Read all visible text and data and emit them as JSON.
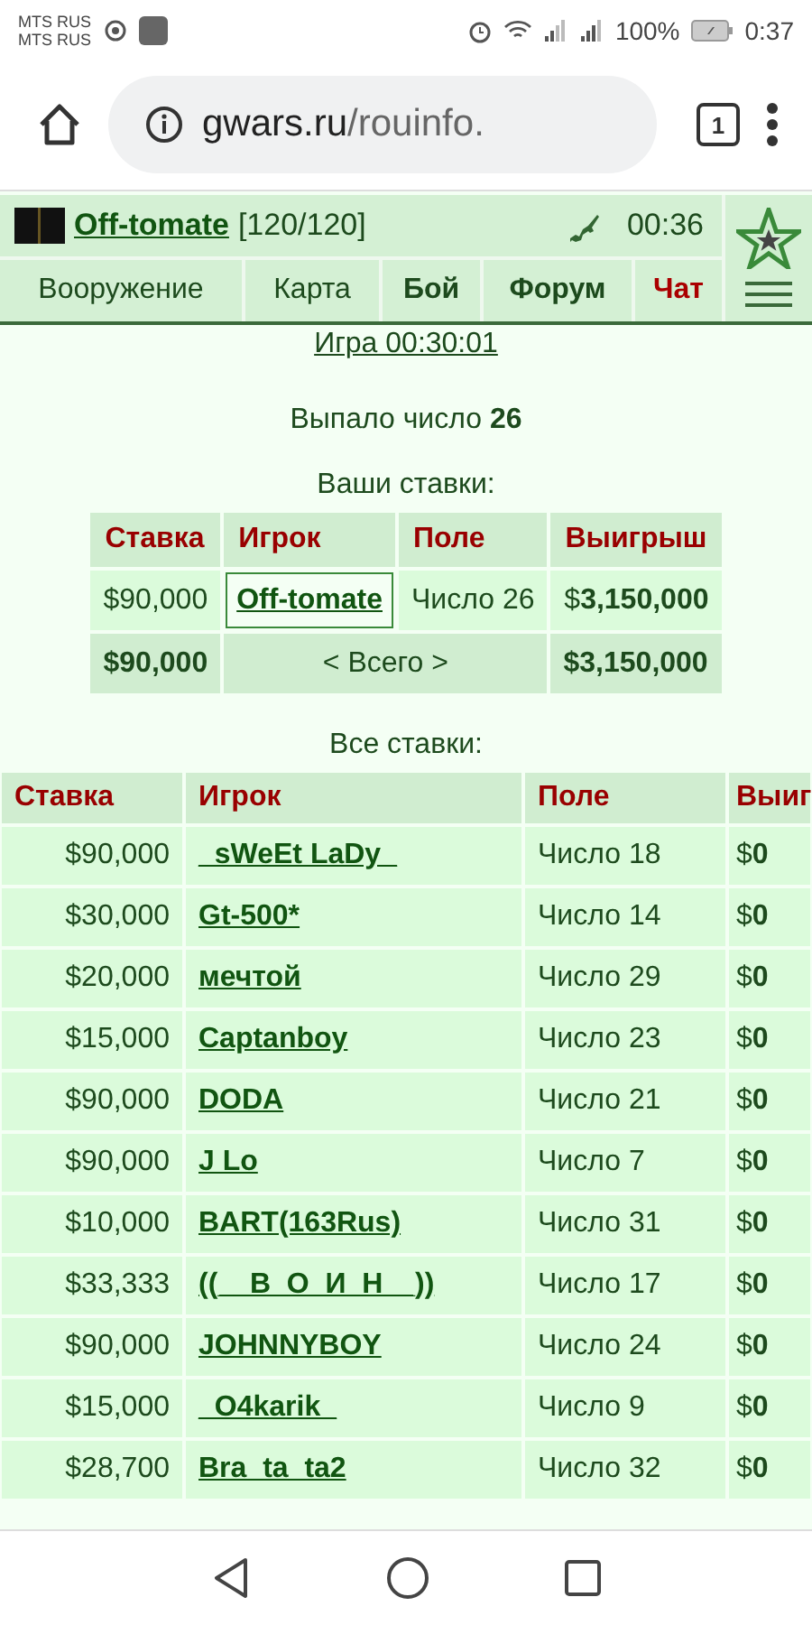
{
  "status_bar": {
    "carrier_1": "MTS RUS",
    "carrier_2": "MTS RUS",
    "battery": "100%",
    "time": "0:37"
  },
  "browser": {
    "url_host": "gwars.ru",
    "url_path": "/rouinfo.",
    "tab_count": "1"
  },
  "header": {
    "player": "Off-tomate",
    "health": "[120/120]",
    "timer": "00:36"
  },
  "nav": [
    {
      "label": "Вооружение",
      "kind": "normal"
    },
    {
      "label": "Карта",
      "kind": "normal"
    },
    {
      "label": "Бой",
      "kind": "bold"
    },
    {
      "label": "Форум",
      "kind": "bold"
    },
    {
      "label": "Чат",
      "kind": "alert"
    }
  ],
  "game_link": "Игра 00:30:01",
  "result": "Выпало число **26**",
  "my_bets": {
    "title": "Ваши ставки:",
    "columns": [
      "Ставка",
      "Игрок",
      "Поле",
      "Выигрыш"
    ],
    "rows": [
      {
        "stake": "$90,000",
        "player": "Off-tomate",
        "field": "Число 26",
        "win": "$**3,150,000**"
      }
    ],
    "total": {
      "stake": "$90,000",
      "label": "< Всего >",
      "win": "$3,150,000"
    }
  },
  "all_bets": {
    "title": "Все ставки:",
    "columns": [
      "Ставка",
      "Игрок",
      "Поле",
      "Выиг"
    ],
    "rows": [
      {
        "stake": "$90,000",
        "player": "_sWeEt LaDy_",
        "field": "Число 18",
        "win": "$**0**"
      },
      {
        "stake": "$30,000",
        "player": "Gt-500*",
        "field": "Число 14",
        "win": "$**0**"
      },
      {
        "stake": "$20,000",
        "player": "мечтой",
        "field": "Число 29",
        "win": "$**0**"
      },
      {
        "stake": "$15,000",
        "player": "Captanboy",
        "field": "Число 23",
        "win": "$**0**"
      },
      {
        "stake": "$90,000",
        "player": "DODA",
        "field": "Число 21",
        "win": "$**0**"
      },
      {
        "stake": "$90,000",
        "player": "J Lo",
        "field": "Число 7",
        "win": "$**0**"
      },
      {
        "stake": "$10,000",
        "player": "BART(163Rus)",
        "field": "Число 31",
        "win": "$**0**"
      },
      {
        "stake": "$33,333",
        "player": "((__В_О_И_Н__))",
        "field": "Число 17",
        "win": "$**0**"
      },
      {
        "stake": "$90,000",
        "player": "JOHNNYBOY",
        "field": "Число 24",
        "win": "$**0**"
      },
      {
        "stake": "$15,000",
        "player": "_O4karik_",
        "field": "Число 9",
        "win": "$**0**"
      },
      {
        "stake": "$28,700",
        "player": "Bra_ta_ta2",
        "field": "Число 32",
        "win": "$**0**"
      }
    ]
  }
}
